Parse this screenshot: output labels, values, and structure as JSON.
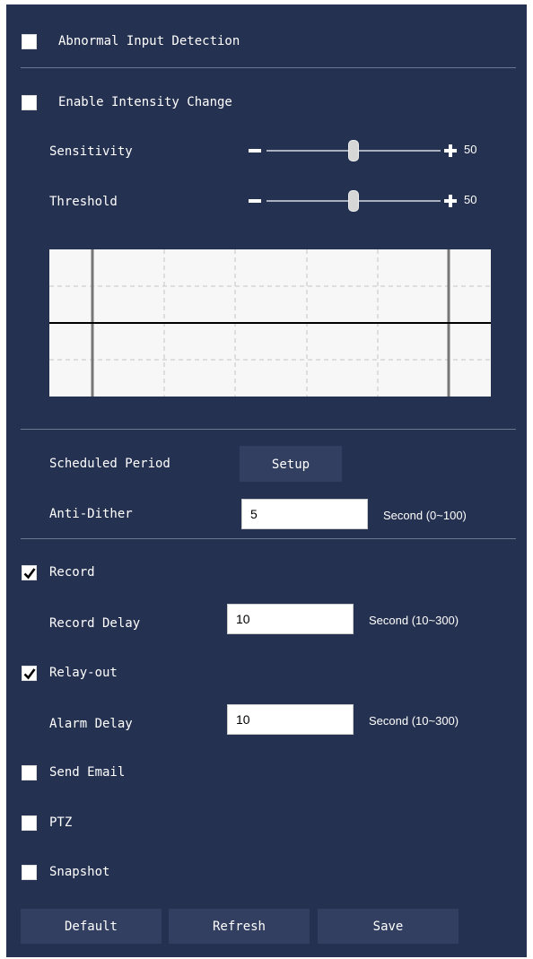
{
  "abnormal_input": {
    "label": "Abnormal Input Detection",
    "checked": false
  },
  "intensity_change": {
    "label": "Enable Intensity Change",
    "checked": false
  },
  "sensitivity": {
    "label": "Sensitivity",
    "minus": "-",
    "plus": "+",
    "value": "50",
    "level": 50
  },
  "threshold": {
    "label": "Threshold",
    "minus": "-",
    "plus": "+",
    "value": "50",
    "level": 50
  },
  "scheduled_period": {
    "label": "Scheduled Period",
    "button_label": "Setup"
  },
  "anti_dither": {
    "label": "Anti-Dither",
    "value": "5",
    "unit": "Second (0~100)"
  },
  "record": {
    "label": "Record",
    "checked": true
  },
  "record_delay": {
    "label": "Record Delay",
    "value": "10",
    "unit": "Second (10~300)"
  },
  "relay_out": {
    "label": "Relay-out",
    "checked": true
  },
  "alarm_delay": {
    "label": "Alarm Delay",
    "value": "10",
    "unit": "Second (10~300)"
  },
  "send_email": {
    "label": "Send Email",
    "checked": false
  },
  "ptz": {
    "label": "PTZ",
    "checked": false
  },
  "snapshot": {
    "label": "Snapshot",
    "checked": false
  },
  "buttons": {
    "default": "Default",
    "refresh": "Refresh",
    "save": "Save"
  },
  "colors": {
    "panel": "#253150",
    "button": "#323f60",
    "divider": "#6b7690"
  }
}
